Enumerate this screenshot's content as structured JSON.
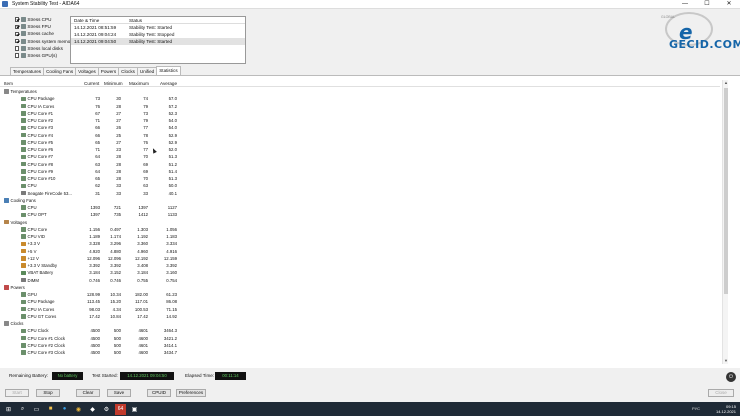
{
  "window": {
    "title": "System Stability Test - AIDA64",
    "minimize": "—",
    "maximize": "☐",
    "close": "✕"
  },
  "stress_options": [
    {
      "label": "Stress CPU",
      "checked": true
    },
    {
      "label": "Stress FPU",
      "checked": true
    },
    {
      "label": "Stress cache",
      "checked": true
    },
    {
      "label": "Stress system memory",
      "checked": true
    },
    {
      "label": "Stress local disks",
      "checked": false
    },
    {
      "label": "Stress GPU(s)",
      "checked": false
    }
  ],
  "log": {
    "headers": [
      "Date & Time",
      "Status"
    ],
    "rows": [
      {
        "time": "14.12.2021 08:51:59",
        "status": "Stability Test: Started"
      },
      {
        "time": "14.12.2021 09:04:24",
        "status": "Stability Test: Stopped"
      },
      {
        "time": "14.12.2021 09:04:50",
        "status": "Stability Test: Started"
      }
    ]
  },
  "logo": {
    "text": "GECID.COM",
    "letter": "e",
    "caption": "GLOBAL"
  },
  "tabs": [
    "Temperatures",
    "Cooling Fans",
    "Voltages",
    "Powers",
    "Clocks",
    "Unified",
    "Statistics"
  ],
  "active_tab": "Statistics",
  "table": {
    "headers": [
      "Item",
      "Current",
      "Minimum",
      "Maximum",
      "Average"
    ],
    "rows": [
      {
        "t": "g",
        "name": "Temperatures",
        "icon": "#888"
      },
      {
        "name": "CPU Package",
        "c": "73",
        "mn": "30",
        "mx": "74",
        "av": "57.0",
        "icon": "#6b8f6b"
      },
      {
        "name": "CPU IA Cores",
        "c": "76",
        "mn": "28",
        "mx": "79",
        "av": "57.2",
        "icon": "#6b8f6b"
      },
      {
        "name": "CPU Core #1",
        "c": "67",
        "mn": "27",
        "mx": "73",
        "av": "52.3",
        "icon": "#6b8f6b"
      },
      {
        "name": "CPU Core #2",
        "c": "71",
        "mn": "27",
        "mx": "79",
        "av": "54.0",
        "icon": "#6b8f6b"
      },
      {
        "name": "CPU Core #3",
        "c": "66",
        "mn": "26",
        "mx": "77",
        "av": "54.0",
        "icon": "#6b8f6b"
      },
      {
        "name": "CPU Core #4",
        "c": "66",
        "mn": "25",
        "mx": "78",
        "av": "52.9",
        "icon": "#6b8f6b"
      },
      {
        "name": "CPU Core #5",
        "c": "65",
        "mn": "27",
        "mx": "76",
        "av": "52.9",
        "icon": "#6b8f6b"
      },
      {
        "name": "CPU Core #6",
        "c": "71",
        "mn": "23",
        "mx": "77",
        "av": "52.0",
        "icon": "#6b8f6b"
      },
      {
        "name": "CPU Core #7",
        "c": "64",
        "mn": "28",
        "mx": "70",
        "av": "51.3",
        "icon": "#6b8f6b"
      },
      {
        "name": "CPU Core #8",
        "c": "63",
        "mn": "28",
        "mx": "69",
        "av": "51.2",
        "icon": "#6b8f6b"
      },
      {
        "name": "CPU Core #9",
        "c": "64",
        "mn": "28",
        "mx": "69",
        "av": "51.4",
        "icon": "#6b8f6b"
      },
      {
        "name": "CPU Core #10",
        "c": "65",
        "mn": "28",
        "mx": "70",
        "av": "51.3",
        "icon": "#6b8f6b"
      },
      {
        "name": "CPU",
        "c": "62",
        "mn": "33",
        "mx": "63",
        "av": "50.0",
        "icon": "#6b8f6b"
      },
      {
        "name": "Seagate FireCode 53...",
        "c": "31",
        "mn": "33",
        "mx": "33",
        "av": "40.1",
        "icon": "#7a7a7a"
      },
      {
        "t": "g",
        "name": "Cooling Fans",
        "icon": "#4a7fb5"
      },
      {
        "name": "CPU",
        "c": "1393",
        "mn": "721",
        "mx": "1397",
        "av": "1127",
        "icon": "#6b8f6b"
      },
      {
        "name": "CPU OPT",
        "c": "1397",
        "mn": "735",
        "mx": "1412",
        "av": "1133",
        "icon": "#6b8f6b"
      },
      {
        "t": "g",
        "name": "Voltages",
        "icon": "#b5844a"
      },
      {
        "name": "CPU Core",
        "c": "1.156",
        "mn": "0.497",
        "mx": "1.303",
        "av": "1.056",
        "icon": "#6b8f6b"
      },
      {
        "name": "CPU VID",
        "c": "1.189",
        "mn": "1.174",
        "mx": "1.192",
        "av": "1.183",
        "icon": "#6b8f6b"
      },
      {
        "name": "+3.3 V",
        "c": "3.328",
        "mn": "3.296",
        "mx": "3.360",
        "av": "3.334",
        "icon": "#c98a2c"
      },
      {
        "name": "+5 V",
        "c": "4.920",
        "mn": "4.880",
        "mx": "4.960",
        "av": "4.916",
        "icon": "#c98a2c"
      },
      {
        "name": "+12 V",
        "c": "12.096",
        "mn": "12.096",
        "mx": "12.192",
        "av": "12.159",
        "icon": "#c98a2c"
      },
      {
        "name": "+3.3 V Standby",
        "c": "3.392",
        "mn": "3.392",
        "mx": "3.408",
        "av": "3.392",
        "icon": "#c98a2c"
      },
      {
        "name": "VBAT Battery",
        "c": "3.184",
        "mn": "3.152",
        "mx": "3.184",
        "av": "3.160",
        "icon": "#5a8a5a"
      },
      {
        "name": "DIMM",
        "c": "0.746",
        "mn": "0.746",
        "mx": "0.755",
        "av": "0.754",
        "icon": "#7a7a7a"
      },
      {
        "t": "g",
        "name": "Powers",
        "icon": "#c04a4a"
      },
      {
        "name": "GPU",
        "c": "128.99",
        "mn": "10.34",
        "mx": "182.00",
        "av": "61.23",
        "icon": "#6b8f6b"
      },
      {
        "name": "CPU Package",
        "c": "113.45",
        "mn": "15.20",
        "mx": "117.01",
        "av": "86.08",
        "icon": "#6b8f6b"
      },
      {
        "name": "CPU IA Cores",
        "c": "98.03",
        "mn": "4.34",
        "mx": "100.53",
        "av": "71.15",
        "icon": "#6b8f6b"
      },
      {
        "name": "CPU GT Cores",
        "c": "17.42",
        "mn": "10.84",
        "mx": "17.42",
        "av": "14.92",
        "icon": "#6b8f6b"
      },
      {
        "t": "g",
        "name": "Clocks",
        "icon": "#888"
      },
      {
        "name": "CPU Clock",
        "c": "4500",
        "mn": "500",
        "mx": "4601",
        "av": "3464.3",
        "icon": "#6b8f6b"
      },
      {
        "name": "CPU Core #1 Clock",
        "c": "4500",
        "mn": "500",
        "mx": "4600",
        "av": "3421.2",
        "icon": "#6b8f6b"
      },
      {
        "name": "CPU Core #2 Clock",
        "c": "4500",
        "mn": "500",
        "mx": "4601",
        "av": "3414.1",
        "icon": "#6b8f6b"
      },
      {
        "name": "CPU Core #3 Clock",
        "c": "4500",
        "mn": "500",
        "mx": "4600",
        "av": "3434.7",
        "icon": "#6b8f6b"
      }
    ]
  },
  "status_bar": {
    "battery_label": "Remaining Battery:",
    "battery_value": "No battery",
    "started_label": "Test Started:",
    "started_value": "14.12.2021 09:04:50",
    "elapsed_label": "Elapsed Time:",
    "elapsed_value": "00:11:14"
  },
  "buttons": {
    "start": "Start",
    "stop": "Stop",
    "clear": "Clear",
    "save": "Save",
    "cpuid": "CPUID",
    "preferences": "Preferences",
    "close": "Close"
  },
  "taskbar": {
    "app_label": "64",
    "lang": "РУС",
    "time": "09:15",
    "date": "14.12.2021"
  }
}
